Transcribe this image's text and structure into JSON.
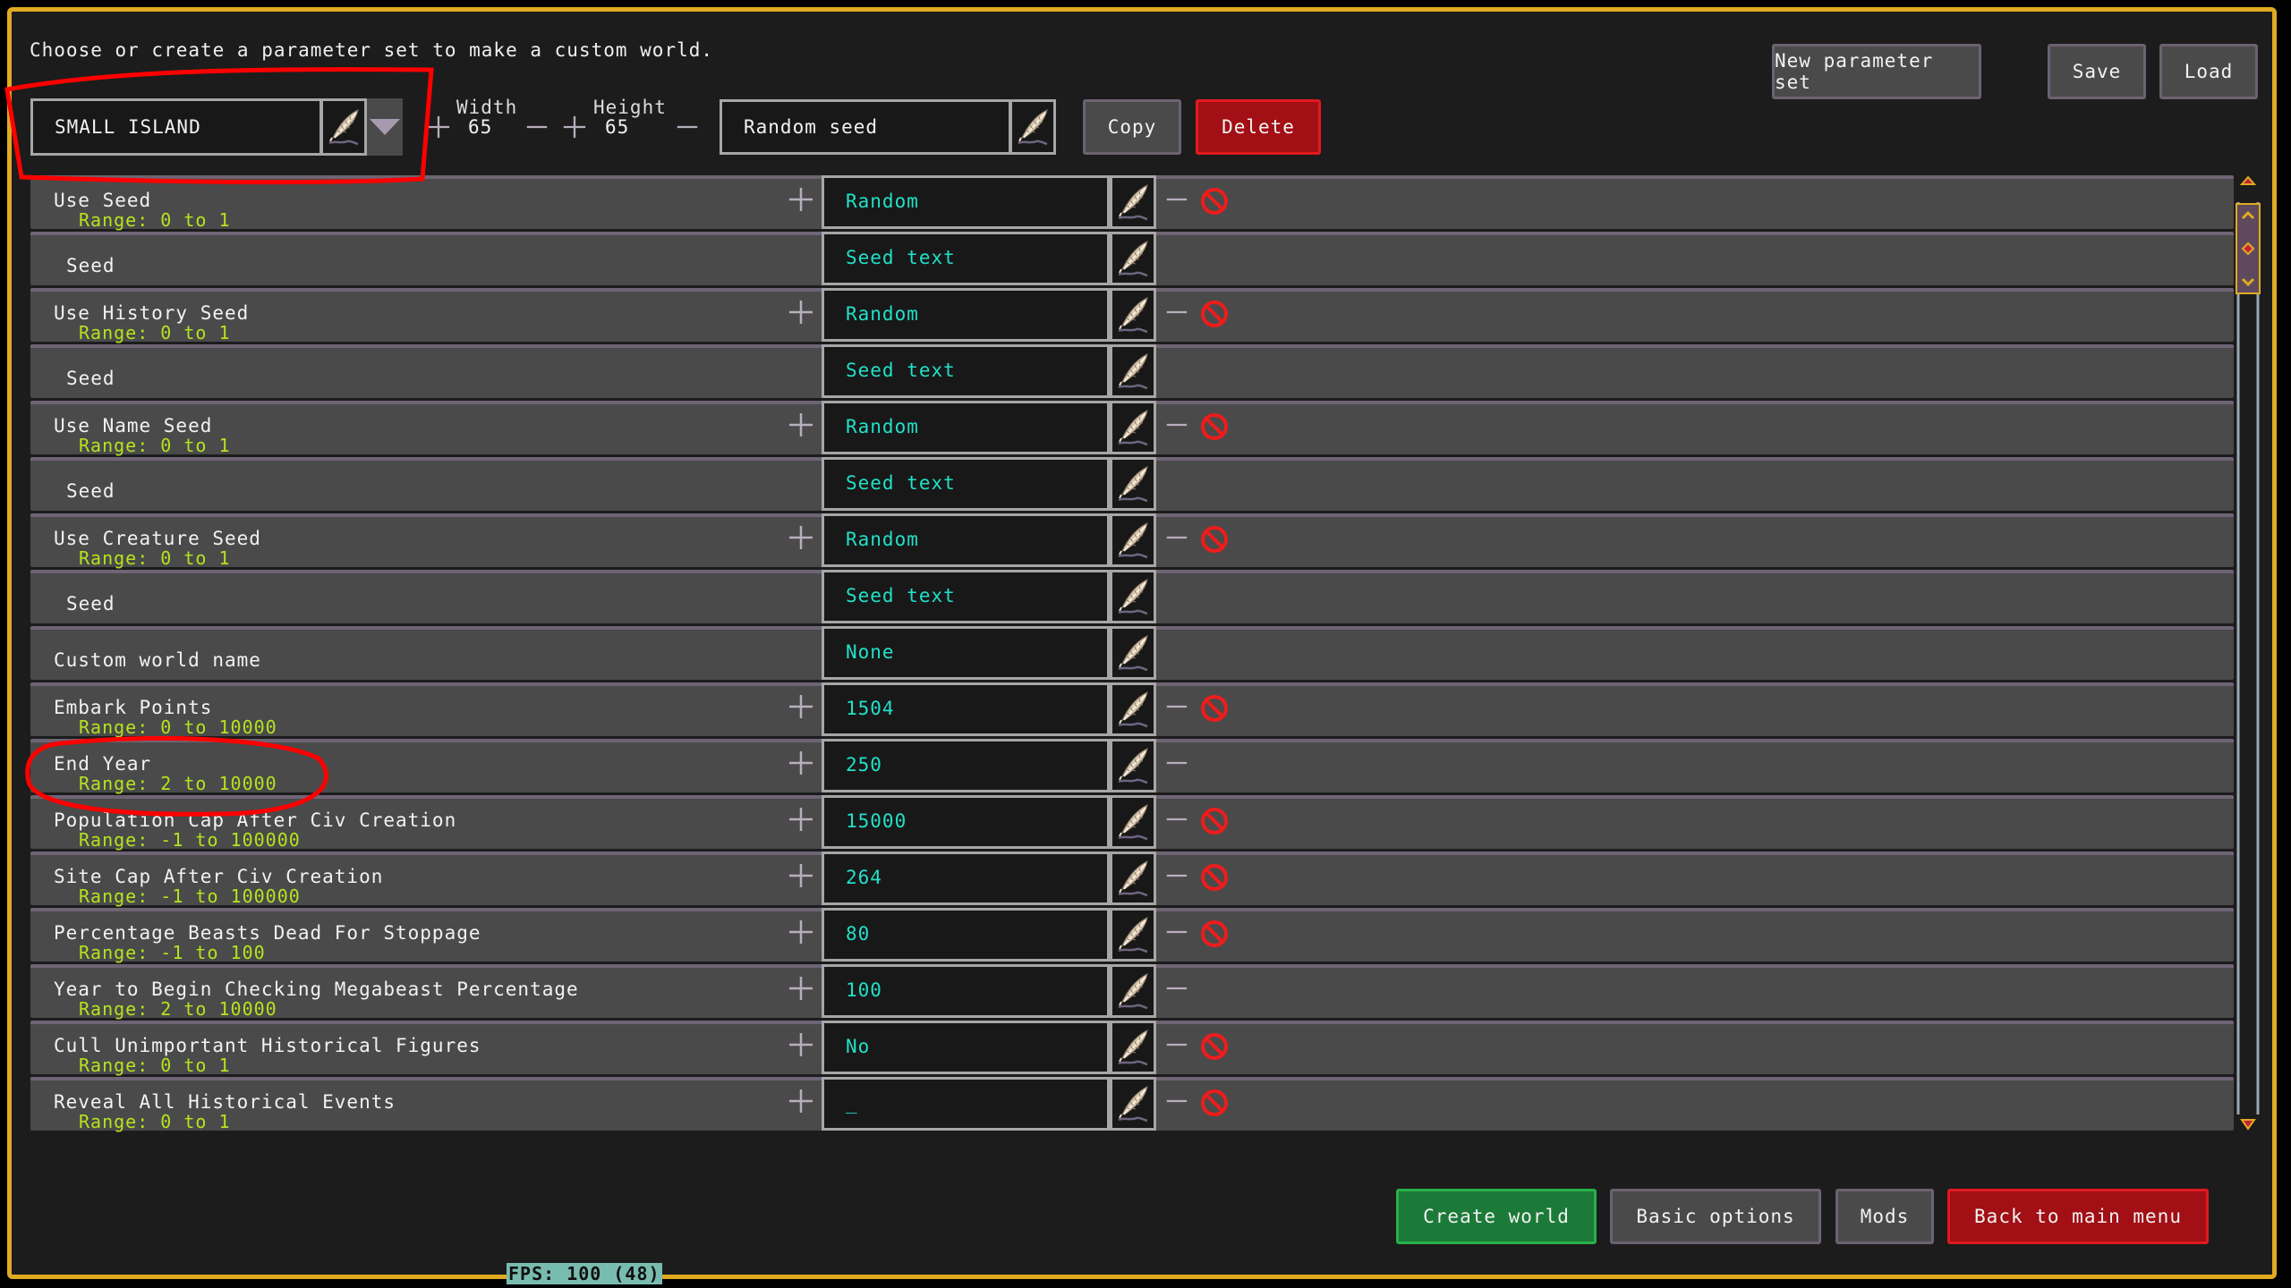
{
  "header": {
    "intro_text": "Choose or create a parameter set to make a custom world.",
    "new_parameter_set_label": "New parameter set",
    "save_label": "Save",
    "load_label": "Load"
  },
  "preset": {
    "name": "SMALL ISLAND",
    "width_label": "Width",
    "width_value": "65",
    "height_label": "Height",
    "height_value": "65",
    "seed_field_value": "Random seed",
    "copy_label": "Copy",
    "delete_label": "Delete"
  },
  "params": [
    {
      "name": "Use Seed",
      "range": "Range: 0 to 1",
      "value": "Random",
      "has_plus": true,
      "has_minus": true,
      "has_no": true
    },
    {
      "name": "Seed",
      "range": null,
      "value": "Seed text",
      "has_plus": false,
      "has_minus": false,
      "has_no": false
    },
    {
      "name": "Use History Seed",
      "range": "Range: 0 to 1",
      "value": "Random",
      "has_plus": true,
      "has_minus": true,
      "has_no": true
    },
    {
      "name": "Seed",
      "range": null,
      "value": "Seed text",
      "has_plus": false,
      "has_minus": false,
      "has_no": false
    },
    {
      "name": "Use Name Seed",
      "range": "Range: 0 to 1",
      "value": "Random",
      "has_plus": true,
      "has_minus": true,
      "has_no": true
    },
    {
      "name": "Seed",
      "range": null,
      "value": "Seed text",
      "has_plus": false,
      "has_minus": false,
      "has_no": false
    },
    {
      "name": "Use Creature Seed",
      "range": "Range: 0 to 1",
      "value": "Random",
      "has_plus": true,
      "has_minus": true,
      "has_no": true
    },
    {
      "name": "Seed",
      "range": null,
      "value": "Seed text",
      "has_plus": false,
      "has_minus": false,
      "has_no": false
    },
    {
      "name": "Custom world name",
      "range": null,
      "value": "None",
      "has_plus": false,
      "has_minus": false,
      "has_no": false
    },
    {
      "name": "Embark Points",
      "range": "Range: 0 to 10000",
      "value": "1504",
      "has_plus": true,
      "has_minus": true,
      "has_no": true
    },
    {
      "name": "End Year",
      "range": "Range: 2 to 10000",
      "value": "250",
      "has_plus": true,
      "has_minus": true,
      "has_no": false
    },
    {
      "name": "Population Cap After Civ Creation",
      "range": "Range: -1 to 100000",
      "value": "15000",
      "has_plus": true,
      "has_minus": true,
      "has_no": true
    },
    {
      "name": "Site Cap After Civ Creation",
      "range": "Range: -1 to 100000",
      "value": "264",
      "has_plus": true,
      "has_minus": true,
      "has_no": true
    },
    {
      "name": "Percentage Beasts Dead For Stoppage",
      "range": "Range: -1 to 100",
      "value": "80",
      "has_plus": true,
      "has_minus": true,
      "has_no": true
    },
    {
      "name": "Year to Begin Checking Megabeast Percentage",
      "range": "Range: 2 to 10000",
      "value": "100",
      "has_plus": true,
      "has_minus": true,
      "has_no": false
    },
    {
      "name": "Cull Unimportant Historical Figures",
      "range": "Range: 0 to 1",
      "value": "No",
      "has_plus": true,
      "has_minus": true,
      "has_no": true
    },
    {
      "name": "Reveal All Historical Events",
      "range": "Range: 0 to 1",
      "value": "_",
      "has_plus": true,
      "has_minus": true,
      "has_no": true
    }
  ],
  "footer": {
    "create_world_label": "Create world",
    "basic_options_label": "Basic options",
    "mods_label": "Mods",
    "back_label": "Back to main menu",
    "fps_text": "FPS: 100 (48)"
  },
  "colors": {
    "frame_gold": "#e0aa22",
    "value_cyan": "#22e0c8",
    "range_green": "#b6e31e",
    "danger_red": "#a20f14",
    "confirm_green": "#1c7a38",
    "annotation_red": "#ff0000"
  }
}
